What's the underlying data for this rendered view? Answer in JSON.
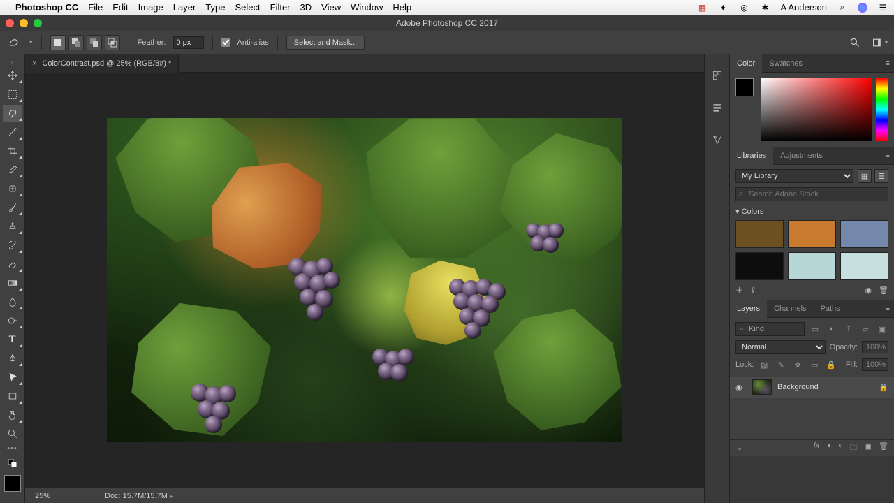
{
  "menubar": {
    "app": "Photoshop CC",
    "items": [
      "File",
      "Edit",
      "Image",
      "Layer",
      "Type",
      "Select",
      "Filter",
      "3D",
      "View",
      "Window",
      "Help"
    ],
    "user": "A Anderson"
  },
  "window": {
    "title": "Adobe Photoshop CC 2017"
  },
  "optionsbar": {
    "feather_label": "Feather:",
    "feather_value": "0 px",
    "antialias_label": "Anti-alias",
    "selectmask_label": "Select and Mask..."
  },
  "document": {
    "tab_title": "ColorContrast.psd @ 25% (RGB/8#) *"
  },
  "statusbar": {
    "zoom": "25%",
    "doc": "Doc: 15.7M/15.7M"
  },
  "panels": {
    "color": {
      "tabs": [
        "Color",
        "Swatches"
      ]
    },
    "libraries": {
      "tabs": [
        "Libraries",
        "Adjustments"
      ],
      "library_name": "My Library",
      "search_placeholder": "Search Adobe Stock",
      "section": "Colors",
      "swatches": [
        "#6b5022",
        "#c97a2e",
        "#7488ab",
        "#0d0d0d",
        "#b7d6d6",
        "#c8dfe0"
      ]
    },
    "layers": {
      "tabs": [
        "Layers",
        "Channels",
        "Paths"
      ],
      "kind_placeholder": "Kind",
      "blend": "Normal",
      "opacity_label": "Opacity:",
      "opacity_value": "100%",
      "lock_label": "Lock:",
      "fill_label": "Fill:",
      "fill_value": "100%",
      "layer0_name": "Background"
    }
  }
}
